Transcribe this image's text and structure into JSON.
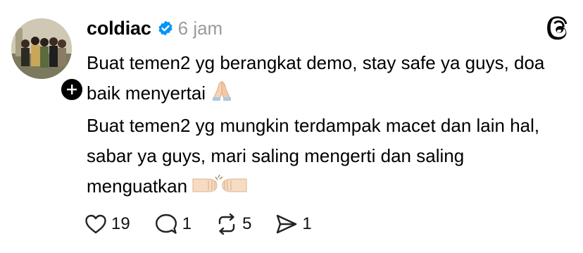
{
  "post": {
    "username": "coldiac",
    "time": "6 jam",
    "paragraphs": [
      "Buat temen2 yg berangkat demo, stay safe ya guys, doa baik menyertai",
      "Buat temen2 yg mungkin terdampak macet dan lain hal, sabar ya guys, mari saling mengerti dan saling menguatkan"
    ],
    "emojis": [
      "folded-hands",
      "fist-bump"
    ]
  },
  "icons": {
    "verified": "verified-badge-icon",
    "app": "threads-logo-icon",
    "follow": "plus-icon"
  },
  "actions": {
    "likes": "19",
    "replies": "1",
    "reposts": "5",
    "shares": "1"
  },
  "colors": {
    "verified": "#0095f6",
    "muted_text": "#9a9a9a",
    "text": "#000000"
  }
}
